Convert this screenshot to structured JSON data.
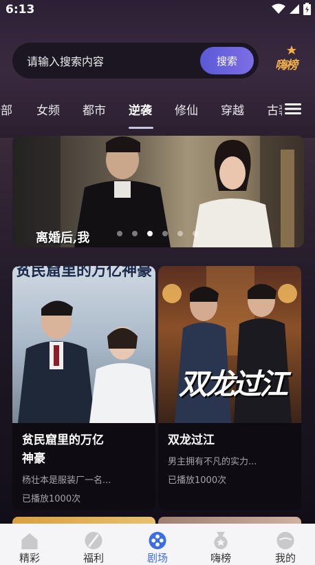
{
  "status_bar": {
    "time": "6:13",
    "icons": [
      "wifi-icon",
      "signal-icon",
      "battery-icon"
    ]
  },
  "search": {
    "placeholder": "请输入搜索内容",
    "button_label": "搜索"
  },
  "hot_rank": {
    "label": "嗨榜"
  },
  "tabs": [
    {
      "label": "全部",
      "active": false
    },
    {
      "label": "女频",
      "active": false
    },
    {
      "label": "都市",
      "active": false
    },
    {
      "label": "逆袭",
      "active": true
    },
    {
      "label": "修仙",
      "active": false
    },
    {
      "label": "穿越",
      "active": false
    },
    {
      "label": "古装",
      "active": false
    }
  ],
  "banner": {
    "caption": "离婚后,我",
    "dot_count": 6,
    "active_dot": 2
  },
  "cards": [
    {
      "cover_text": "贫民窟里的万亿神豪",
      "title_line1": "贫民窟里的万亿",
      "title_line2": "神豪",
      "desc": "杨壮本是服装厂一名...",
      "plays": "已播放1000次"
    },
    {
      "cover_text": "双龙过江",
      "title_line1": "双龙过江",
      "title_line2": "",
      "desc": "男主拥有不凡的实力...",
      "plays": "已播放1000次"
    }
  ],
  "bottom_nav": [
    {
      "label": "精彩",
      "icon": "home-icon",
      "active": false
    },
    {
      "label": "福利",
      "icon": "welfare-icon",
      "active": false
    },
    {
      "label": "剧场",
      "icon": "theater-icon",
      "active": true
    },
    {
      "label": "嗨榜",
      "icon": "rank-medal-icon",
      "active": false
    },
    {
      "label": "我的",
      "icon": "profile-icon",
      "active": false
    }
  ],
  "colors": {
    "accent": "#3b6de6",
    "search_button": "#6a63e0",
    "hot_rank": "#f2b04a"
  }
}
